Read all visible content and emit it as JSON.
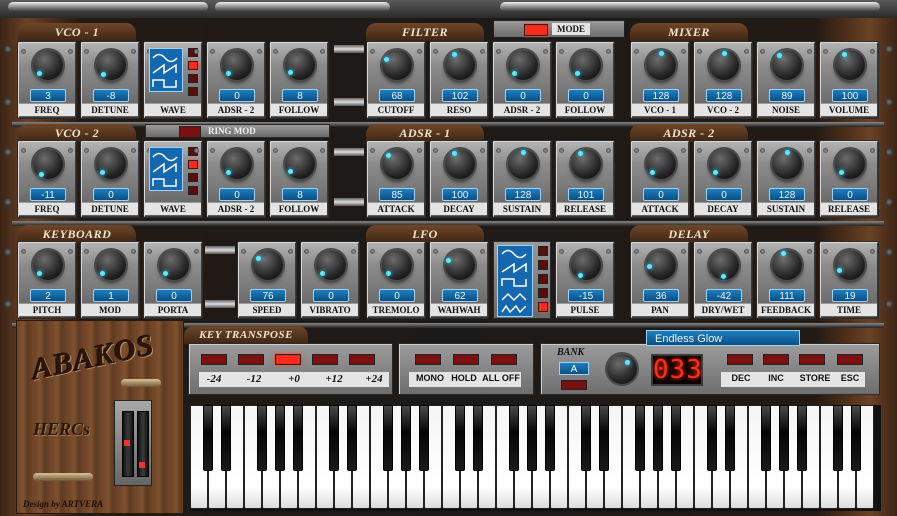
{
  "colors": {
    "led_on": "#ff2a1a",
    "led_off": "#7a1010",
    "display_blue": "#1468b0",
    "knob_dot": "#5ee8ff"
  },
  "sections": {
    "vco1": "VCO - 1",
    "filter": "FILTER",
    "mixer": "MIXER",
    "vco2": "VCO - 2",
    "adsr1": "ADSR - 1",
    "adsr2": "ADSR - 2",
    "keyboard": "KEYBOARD",
    "lfo": "LFO",
    "delay": "DELAY",
    "key_transpose": "KEY TRANSPOSE"
  },
  "mode_label": "MODE",
  "ring_mod_label": "RING MOD",
  "knobs": {
    "vco1": [
      {
        "label": "FREQ",
        "value": "3"
      },
      {
        "label": "DETUNE",
        "value": "-8"
      },
      {
        "label": "WAVE",
        "wave": true
      },
      {
        "label": "ADSR - 2",
        "value": "0"
      },
      {
        "label": "FOLLOW",
        "value": "8"
      }
    ],
    "filter": [
      {
        "label": "CUTOFF",
        "value": "68"
      },
      {
        "label": "RESO",
        "value": "102"
      },
      {
        "label": "ADSR - 2",
        "value": "0"
      },
      {
        "label": "FOLLOW",
        "value": "0"
      }
    ],
    "mixer": [
      {
        "label": "VCO - 1",
        "value": "128"
      },
      {
        "label": "VCO - 2",
        "value": "128"
      },
      {
        "label": "NOISE",
        "value": "89"
      },
      {
        "label": "VOLUME",
        "value": "100"
      }
    ],
    "vco2": [
      {
        "label": "FREQ",
        "value": "-11"
      },
      {
        "label": "DETUNE",
        "value": "0"
      },
      {
        "label": "WAVE",
        "wave": true
      },
      {
        "label": "ADSR - 2",
        "value": "0"
      },
      {
        "label": "FOLLOW",
        "value": "8"
      }
    ],
    "adsr1": [
      {
        "label": "ATTACK",
        "value": "85"
      },
      {
        "label": "DECAY",
        "value": "100"
      },
      {
        "label": "SUSTAIN",
        "value": "128"
      },
      {
        "label": "RELEASE",
        "value": "101"
      }
    ],
    "adsr2": [
      {
        "label": "ATTACK",
        "value": "0"
      },
      {
        "label": "DECAY",
        "value": "0"
      },
      {
        "label": "SUSTAIN",
        "value": "128"
      },
      {
        "label": "RELEASE",
        "value": "0"
      }
    ],
    "keyboard": [
      {
        "label": "PITCH",
        "value": "2"
      },
      {
        "label": "MOD",
        "value": "1"
      },
      {
        "label": "PORTA",
        "value": "0"
      }
    ],
    "lfo": [
      {
        "label": "SPEED",
        "value": "76"
      },
      {
        "label": "VIBRATO",
        "value": "0"
      },
      {
        "label": "TREMOLO",
        "value": "0"
      },
      {
        "label": "WAHWAH",
        "value": "62"
      }
    ],
    "lfo_pulse": {
      "label": "PULSE",
      "value": "-15"
    },
    "delay": [
      {
        "label": "PAN",
        "value": "36"
      },
      {
        "label": "DRY/WET",
        "value": "-42"
      },
      {
        "label": "FEEDBACK",
        "value": "111"
      },
      {
        "label": "TIME",
        "value": "19"
      }
    ]
  },
  "transpose": {
    "labels": [
      "-24",
      "-12",
      "+0",
      "+12",
      "+24"
    ],
    "active": 2
  },
  "play_modes": [
    "MONO",
    "HOLD",
    "ALL OFF"
  ],
  "patch": {
    "bank_label": "BANK",
    "bank": "A",
    "number": "033",
    "buttons": [
      "DEC",
      "INC",
      "STORE",
      "ESC"
    ],
    "preset_name": "Endless Glow"
  },
  "logo": {
    "name": "ABAKOS",
    "sub": "HERCs",
    "credit": "Design by ARTVERA"
  }
}
